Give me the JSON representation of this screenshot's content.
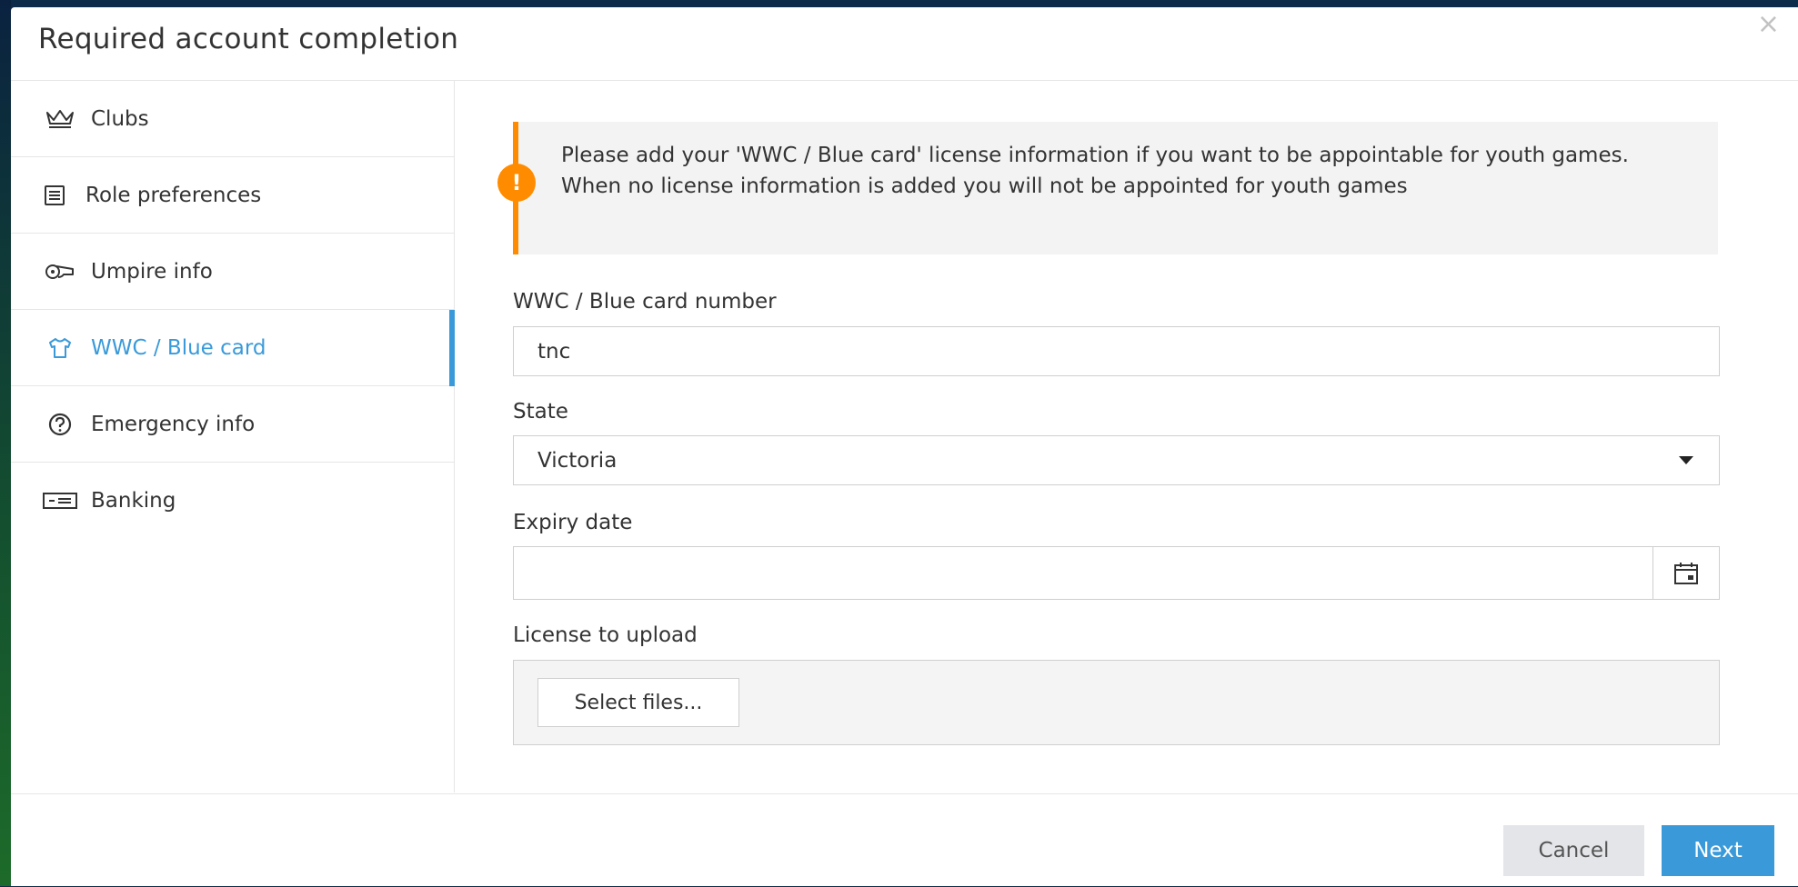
{
  "modal": {
    "title": "Required account completion",
    "close_symbol": "×"
  },
  "sidebar": {
    "items": [
      {
        "label": "Clubs",
        "icon": "crown-icon",
        "active": false
      },
      {
        "label": "Role preferences",
        "icon": "list-icon",
        "active": false
      },
      {
        "label": "Umpire info",
        "icon": "whistle-icon",
        "active": false
      },
      {
        "label": "WWC / Blue card",
        "icon": "shirt-icon",
        "active": true
      },
      {
        "label": "Emergency info",
        "icon": "help-circle-icon",
        "active": false
      },
      {
        "label": "Banking",
        "icon": "bank-card-icon",
        "active": false
      }
    ]
  },
  "main": {
    "alert": {
      "icon_text": "!",
      "message": "Please add your 'WWC / Blue card' license information if you want to be appointable for youth games. When no license information is added you will not be appointed for youth games"
    },
    "card_number": {
      "label": "WWC / Blue card number",
      "value": "tnc"
    },
    "state": {
      "label": "State",
      "value": "Victoria"
    },
    "expiry": {
      "label": "Expiry date",
      "value": ""
    },
    "license": {
      "label": "License to upload",
      "button": "Select files..."
    }
  },
  "footer": {
    "cancel_label": "Cancel",
    "next_label": "Next"
  },
  "colors": {
    "accent": "#3a9ad9",
    "warning": "#ff8c00",
    "text": "#333333"
  }
}
